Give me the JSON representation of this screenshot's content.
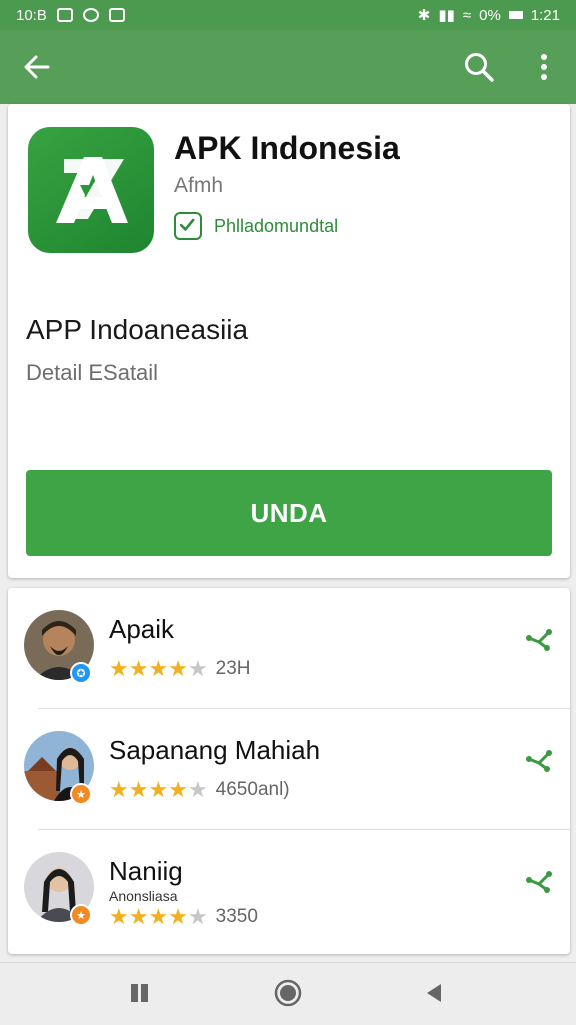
{
  "status_bar": {
    "left_time": "10:B",
    "battery_text": "0%",
    "clock": "1:21"
  },
  "app_bar": {
    "back_icon": "arrow-left-icon",
    "search_icon": "search-icon",
    "menu_icon": "more-vert-icon"
  },
  "app": {
    "title": "APK Indonesia",
    "developer": "Afmh",
    "verified_label": "Phlladomundtal",
    "icon_letter": "A",
    "brand_color": "#3fa445"
  },
  "details": {
    "title": "APP Indoaneasiia",
    "subtitle": "Detail ESatail"
  },
  "install_button": {
    "label": "UNDA"
  },
  "list": [
    {
      "name": "Apaik",
      "sub": "",
      "rating": 4,
      "count": "23H",
      "badge_color": "#2196f3",
      "badge_icon": "star-badge-icon"
    },
    {
      "name": "Sapanang Mahiah",
      "sub": "",
      "rating": 4,
      "count": "4650anl)",
      "badge_color": "#f08a24",
      "badge_icon": "star-badge-icon"
    },
    {
      "name": "Naniig",
      "sub": "Anonsliasa",
      "rating": 4,
      "count": "3350",
      "badge_color": "#f08a24",
      "badge_icon": "star-badge-icon"
    }
  ]
}
